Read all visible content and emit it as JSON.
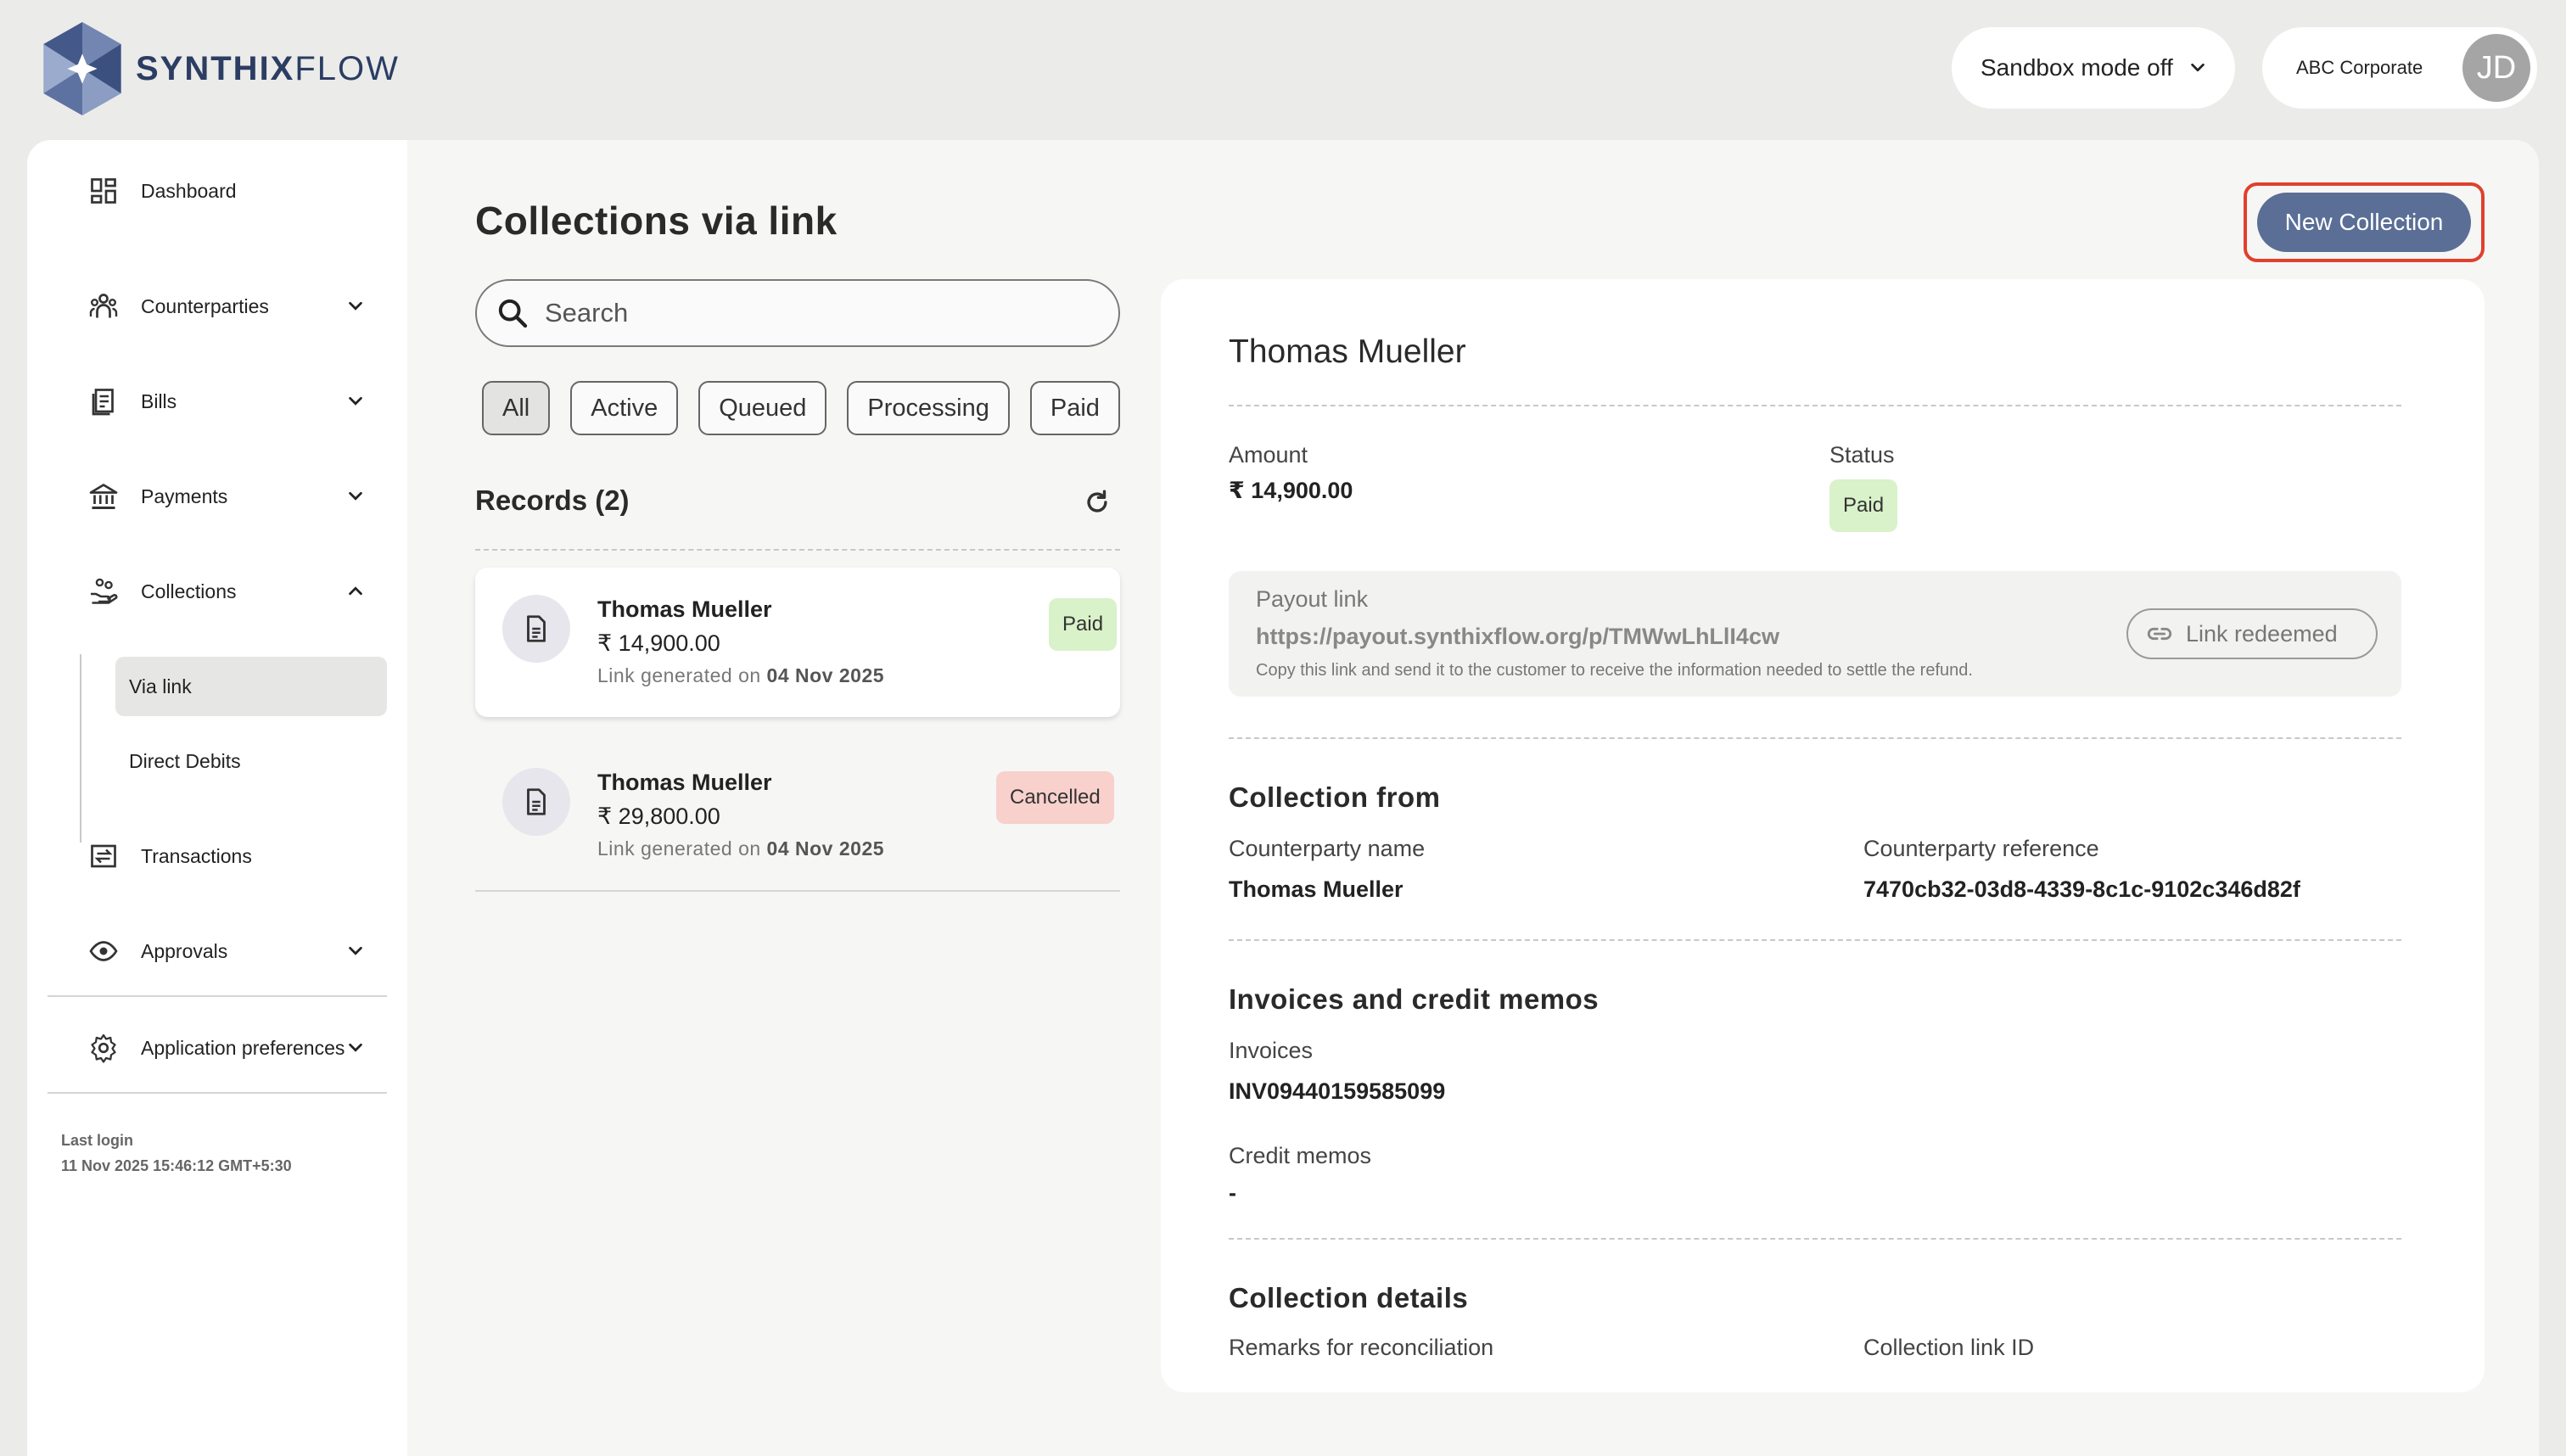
{
  "brand": {
    "name_bold": "SYNTHIX",
    "name_light": "FLOW"
  },
  "header": {
    "sandbox_label": "Sandbox mode off",
    "company": "ABC Corporate",
    "avatar_initials": "JD"
  },
  "sidebar": {
    "items": [
      {
        "label": "Dashboard"
      },
      {
        "label": "Counterparties"
      },
      {
        "label": "Bills"
      },
      {
        "label": "Payments"
      },
      {
        "label": "Collections"
      },
      {
        "label": "Transactions"
      },
      {
        "label": "Approvals"
      },
      {
        "label": "Application preferences"
      }
    ],
    "collections_sub": [
      {
        "label": "Via link"
      },
      {
        "label": "Direct Debits"
      }
    ],
    "last_login_label": "Last login",
    "last_login_value": "11 Nov 2025 15:46:12 GMT+5:30"
  },
  "main": {
    "title": "Collections via link",
    "new_button": "New Collection",
    "search_placeholder": "Search",
    "filters": [
      "All",
      "Active",
      "Queued",
      "Processing",
      "Paid"
    ],
    "records_title": "Records (2)",
    "records": [
      {
        "name": "Thomas Mueller",
        "amount": "₹ 14,900.00",
        "date_prefix": "Link generated on",
        "date": "04 Nov 2025",
        "status": "Paid"
      },
      {
        "name": "Thomas Mueller",
        "amount": "₹ 29,800.00",
        "date_prefix": "Link generated on",
        "date": "04 Nov 2025",
        "status": "Cancelled"
      }
    ]
  },
  "detail": {
    "name": "Thomas Mueller",
    "amount_label": "Amount",
    "amount_value": "₹ 14,900.00",
    "status_label": "Status",
    "status_value": "Paid",
    "payout_label": "Payout link",
    "payout_url": "https://payout.synthixflow.org/p/TMWwLhLlI4cw",
    "payout_hint": "Copy this link and send it to the customer to receive the information needed to settle the refund.",
    "redeemed_label": "Link redeemed",
    "collection_from_title": "Collection from",
    "cp_name_label": "Counterparty name",
    "cp_name_value": "Thomas Mueller",
    "cp_ref_label": "Counterparty reference",
    "cp_ref_value": "7470cb32-03d8-4339-8c1c-9102c346d82f",
    "invoices_title": "Invoices and credit memos",
    "invoices_label": "Invoices",
    "invoices_value": "INV09440159585099",
    "credit_label": "Credit memos",
    "credit_value": "-",
    "details_title": "Collection details",
    "remarks_label": "Remarks for reconciliation",
    "link_id_label": "Collection link ID"
  },
  "colors": {
    "accent_button": "#5a6e96",
    "highlight_border": "#e0402e",
    "paid_badge": "#d9f2c9",
    "cancelled_badge": "#f8d0cc"
  }
}
